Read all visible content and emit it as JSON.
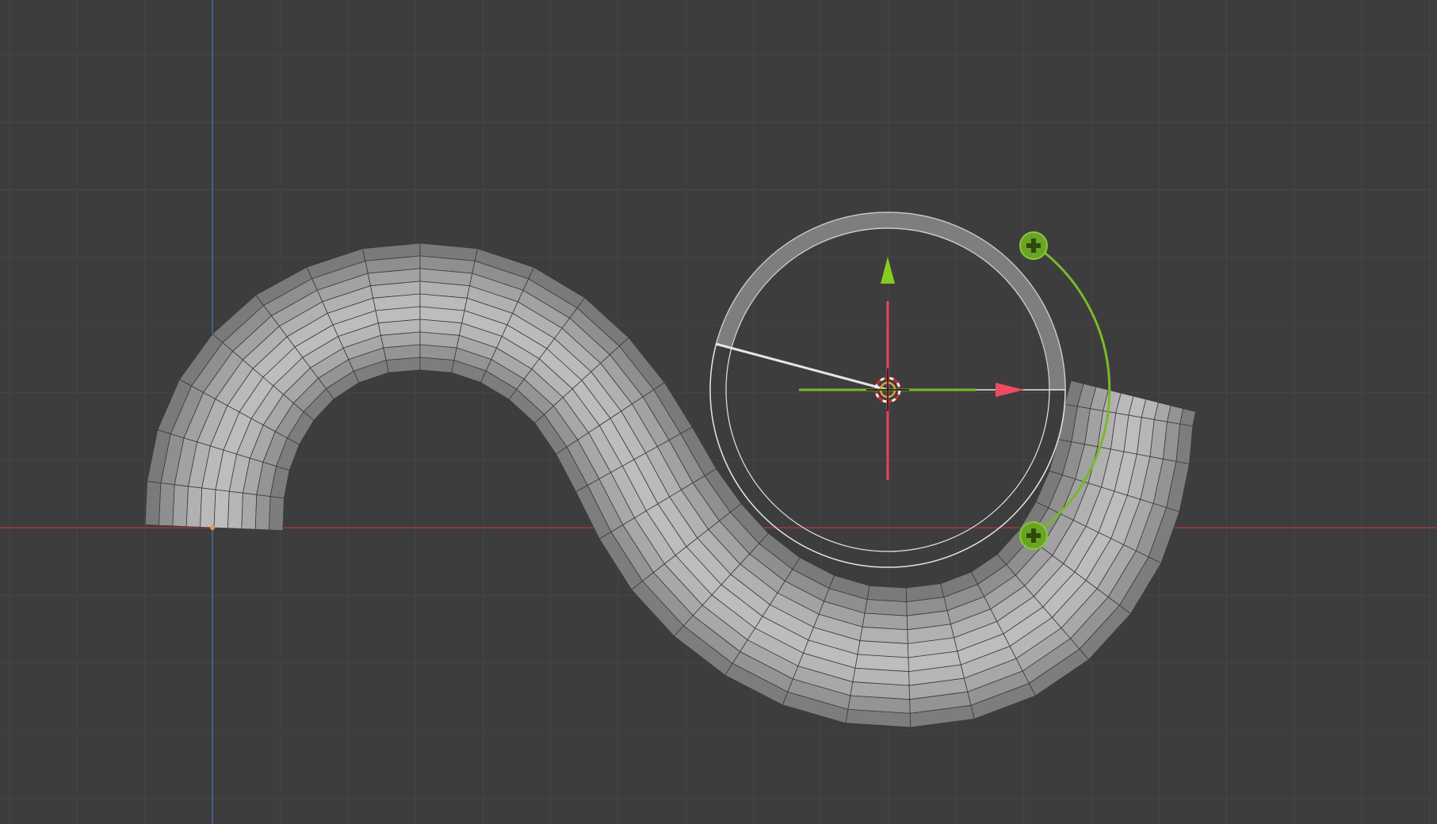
{
  "app": {
    "viewport_kind": "3D viewport (top orthographic, edit mode)"
  },
  "colors": {
    "background": "#3d3d3d",
    "grid_minor": "#464646",
    "grid_major": "#4a4a4a",
    "axis_x": "#a3373d",
    "axis_y": "#3f6fa6",
    "mesh_light": "#b8b8b8",
    "mesh_dark": "#6f6f6f",
    "mesh_edge": "#2e2e2e",
    "gizmo_green": "#7ab82a",
    "gizmo_red": "#e8455a",
    "gizmo_white": "#e6e6e6",
    "cursor_orange": "#e09f3e"
  },
  "scene": {
    "object": "tube-mesh",
    "tool": "spin-tool",
    "spin_handles": [
      "plus-icon",
      "plus-icon"
    ],
    "cursor_icon": "3d-cursor-icon"
  }
}
